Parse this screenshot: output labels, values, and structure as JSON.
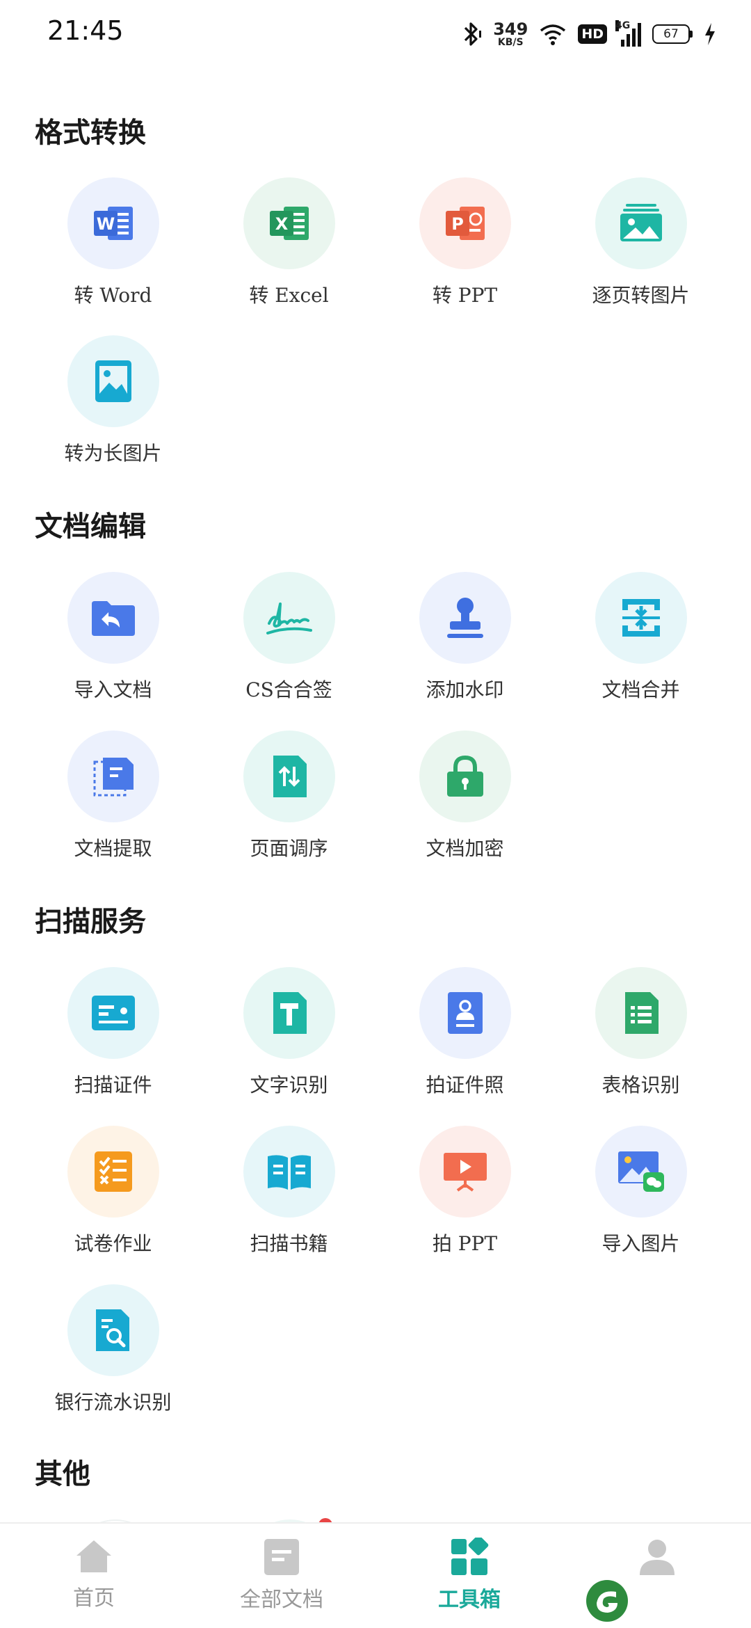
{
  "status_bar": {
    "time": "21:45",
    "net_speed": "349",
    "net_unit": "KB/S",
    "hd": "HD",
    "signal_type": "4G",
    "battery": "67"
  },
  "sections": [
    {
      "title": "格式转换",
      "tools": [
        {
          "label": "转 Word",
          "icon": "word-icon",
          "bg": "#ECF1FD",
          "color": "#4A79E8"
        },
        {
          "label": "转 Excel",
          "icon": "excel-icon",
          "bg": "#EAF6EF",
          "color": "#2EA86A"
        },
        {
          "label": "转 PPT",
          "icon": "ppt-icon",
          "bg": "#FDEDEA",
          "color": "#F26D4F"
        },
        {
          "label": "逐页转图片",
          "icon": "pages-to-image-icon",
          "bg": "#E6F7F4",
          "color": "#1EB6A4"
        },
        {
          "label": "转为长图片",
          "icon": "long-image-icon",
          "bg": "#E6F6F9",
          "color": "#17A9D1"
        }
      ]
    },
    {
      "title": "文档编辑",
      "tools": [
        {
          "label": "导入文档",
          "icon": "import-folder-icon",
          "bg": "#ECF1FD",
          "color": "#4A79E8"
        },
        {
          "label": "CS合合签",
          "icon": "signature-icon",
          "bg": "#E6F7F4",
          "color": "#1EB6A4"
        },
        {
          "label": "添加水印",
          "icon": "stamp-icon",
          "bg": "#ECF1FD",
          "color": "#3F6FE0"
        },
        {
          "label": "文档合并",
          "icon": "merge-icon",
          "bg": "#E6F6F9",
          "color": "#17A9D1"
        },
        {
          "label": "文档提取",
          "icon": "extract-icon",
          "bg": "#ECF1FD",
          "color": "#4A79E8"
        },
        {
          "label": "页面调序",
          "icon": "reorder-icon",
          "bg": "#E6F7F4",
          "color": "#1EB6A4"
        },
        {
          "label": "文档加密",
          "icon": "lock-icon",
          "bg": "#EAF6EF",
          "color": "#2EA86A"
        }
      ]
    },
    {
      "title": "扫描服务",
      "tools": [
        {
          "label": "扫描证件",
          "icon": "id-card-icon",
          "bg": "#E6F6F9",
          "color": "#17A9D1"
        },
        {
          "label": "文字识别",
          "icon": "text-ocr-icon",
          "bg": "#E6F7F4",
          "color": "#1EB6A4"
        },
        {
          "label": "拍证件照",
          "icon": "id-photo-icon",
          "bg": "#ECF1FD",
          "color": "#4A79E8"
        },
        {
          "label": "表格识别",
          "icon": "table-icon",
          "bg": "#EAF6EF",
          "color": "#2EA86A"
        },
        {
          "label": "试卷作业",
          "icon": "exam-icon",
          "bg": "#FEF3E6",
          "color": "#F59A1E"
        },
        {
          "label": "扫描书籍",
          "icon": "book-icon",
          "bg": "#E6F6F9",
          "color": "#17A9D1"
        },
        {
          "label": "拍 PPT",
          "icon": "presentation-icon",
          "bg": "#FDEDEA",
          "color": "#F26D4F"
        },
        {
          "label": "导入图片",
          "icon": "import-image-icon",
          "bg": "#ECF1FD",
          "color": "#4A79E8"
        },
        {
          "label": "银行流水识别",
          "icon": "bank-statement-icon",
          "bg": "#E6F6F9",
          "color": "#17A9D1"
        }
      ]
    },
    {
      "title": "其他",
      "tools": []
    }
  ],
  "bottom_nav": [
    {
      "label": "首页",
      "icon": "home-icon"
    },
    {
      "label": "全部文档",
      "icon": "documents-icon"
    },
    {
      "label": "工具箱",
      "icon": "toolbox-icon",
      "active": true
    },
    {
      "label": "",
      "icon": "profile-icon"
    }
  ],
  "colors": {
    "accent": "#1AA99A",
    "inactive": "#999999",
    "badge": "#E84545"
  }
}
